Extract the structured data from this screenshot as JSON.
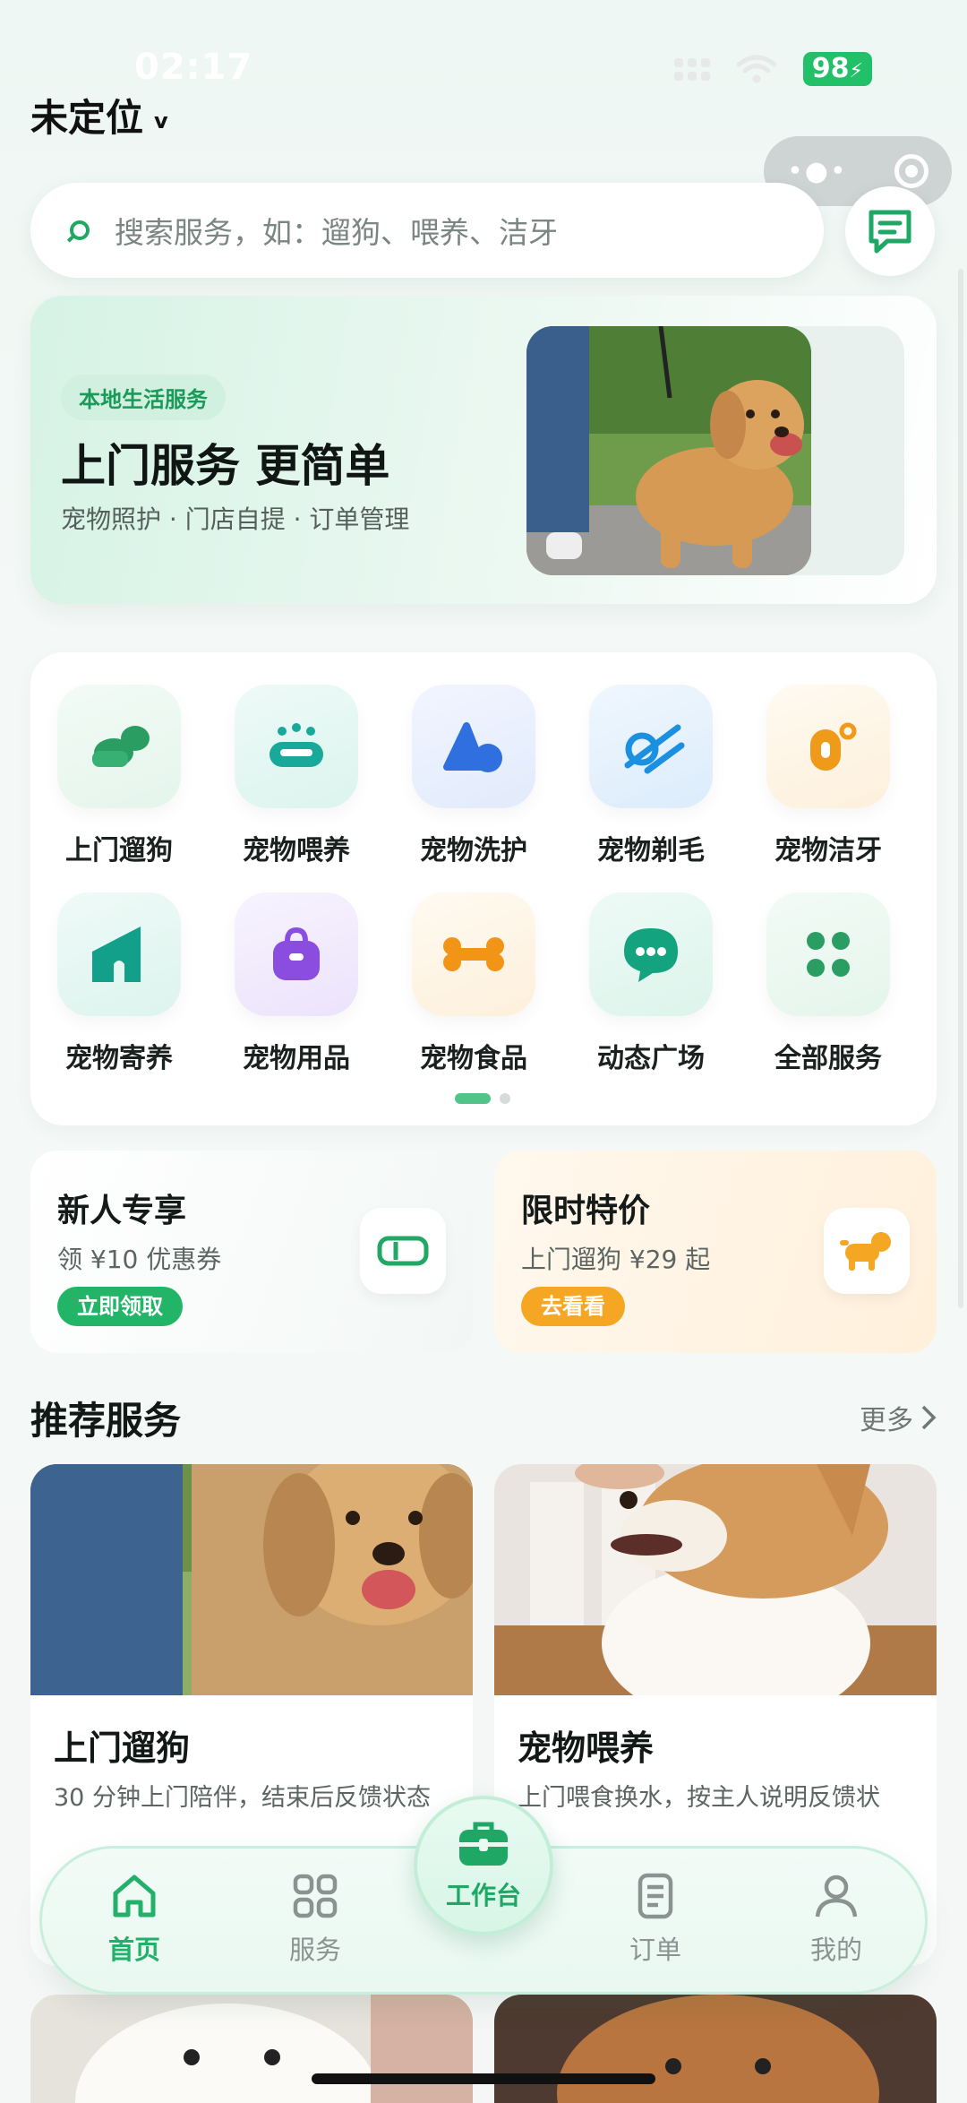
{
  "status_bar": {
    "time": "02:17",
    "battery": "98"
  },
  "location": {
    "label": "未定位"
  },
  "search": {
    "placeholder": "搜索服务，如：遛狗、喂养、洁牙"
  },
  "banner": {
    "tag": "本地生活服务",
    "title": "上门服务 更简单",
    "subtitle": "宠物照护 · 门店自提 · 订单管理"
  },
  "categories": [
    {
      "label": "上门遛狗",
      "icon": "dog-walk-icon",
      "color": "#2a9d63"
    },
    {
      "label": "宠物喂养",
      "icon": "pet-bowl-icon",
      "color": "#18a99a"
    },
    {
      "label": "宠物洗护",
      "icon": "bath-shapes-icon",
      "color": "#2f6fe0"
    },
    {
      "label": "宠物剃毛",
      "icon": "clipper-icon",
      "color": "#1b8fe0"
    },
    {
      "label": "宠物洁牙",
      "icon": "toothbrush-icon",
      "color": "#f09a1a"
    },
    {
      "label": "宠物寄养",
      "icon": "pet-house-icon",
      "color": "#13a08a"
    },
    {
      "label": "宠物用品",
      "icon": "bag-icon",
      "color": "#8a4de0"
    },
    {
      "label": "宠物食品",
      "icon": "bone-icon",
      "color": "#f29416"
    },
    {
      "label": "动态广场",
      "icon": "chat-bubble-icon",
      "color": "#14a37f"
    },
    {
      "label": "全部服务",
      "icon": "grid-dots-icon",
      "color": "#2a9d63"
    }
  ],
  "promos": {
    "new_user": {
      "title": "新人专享",
      "subtitle": "领 ¥10 优惠券",
      "button": "立即领取",
      "icon": "coupon-icon"
    },
    "limited": {
      "title": "限时特价",
      "subtitle": "上门遛狗 ¥29 起",
      "button": "去看看",
      "icon": "dog-icon"
    }
  },
  "recommend": {
    "title": "推荐服务",
    "more": "更多",
    "items": [
      {
        "title": "上门遛狗",
        "desc": "30 分钟上门陪伴，结束后反馈状态"
      },
      {
        "title": "宠物喂养",
        "desc": "上门喂食换水，按主人说明反馈状"
      }
    ]
  },
  "tabbar": {
    "items": [
      {
        "label": "首页",
        "icon": "home-icon",
        "active": true
      },
      {
        "label": "服务",
        "icon": "grid-icon",
        "active": false
      },
      {
        "label": "工作台",
        "icon": "briefcase-icon",
        "active": false
      },
      {
        "label": "订单",
        "icon": "order-list-icon",
        "active": false
      },
      {
        "label": "我的",
        "icon": "user-icon",
        "active": false
      }
    ]
  },
  "colors": {
    "accent": "#22b06a",
    "orange": "#f5a623"
  }
}
